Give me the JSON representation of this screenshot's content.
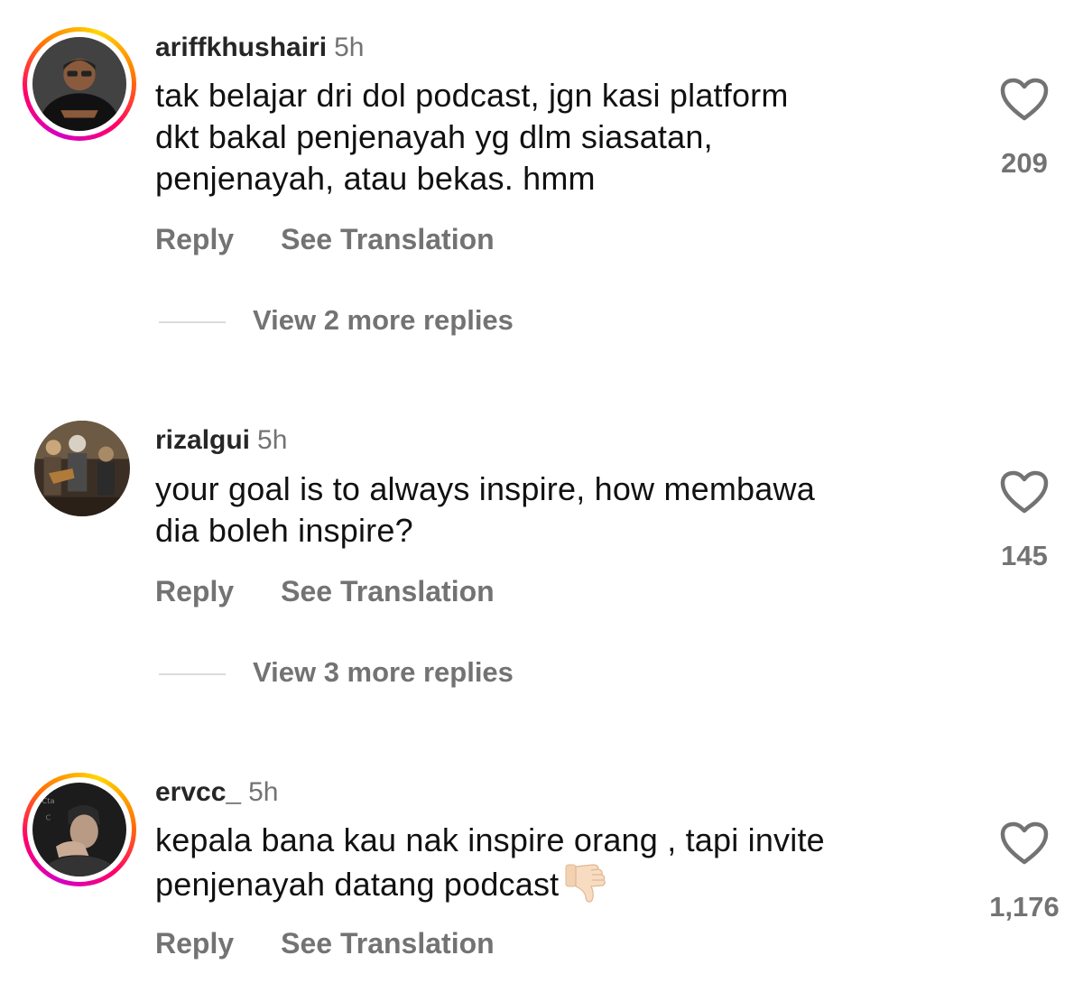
{
  "comments": [
    {
      "username": "ariffkhushairi",
      "time": "5h",
      "text_lines": [
        "tak belajar dri dol podcast, jgn kasi platform",
        "dkt bakal penjenayah yg dlm siasatan,",
        "penjenayah, atau bekas. hmm"
      ],
      "likes": "209",
      "reply_label": "Reply",
      "translate_label": "See Translation",
      "view_replies": "View 2 more replies",
      "has_story": true
    },
    {
      "username": "rizalgui",
      "time": "5h",
      "text_lines": [
        "your goal is to always inspire, how membawa",
        "dia boleh inspire?"
      ],
      "likes": "145",
      "reply_label": "Reply",
      "translate_label": "See Translation",
      "view_replies": "View 3 more replies",
      "has_story": false
    },
    {
      "username": "ervcc_",
      "time": "5h",
      "text_lines": [
        "kepala bana kau nak inspire orang , tapi invite",
        "penjenayah datang podcast"
      ],
      "emoji": "thumbs-down-icon",
      "likes": "1,176",
      "reply_label": "Reply",
      "translate_label": "See Translation",
      "has_story": true
    }
  ],
  "colors": {
    "text": "#111111",
    "secondary": "#737373",
    "divider": "#dbdbdb",
    "story_ring": [
      "#d300c5",
      "#ff0069",
      "#ff7a00",
      "#ffd600"
    ]
  }
}
